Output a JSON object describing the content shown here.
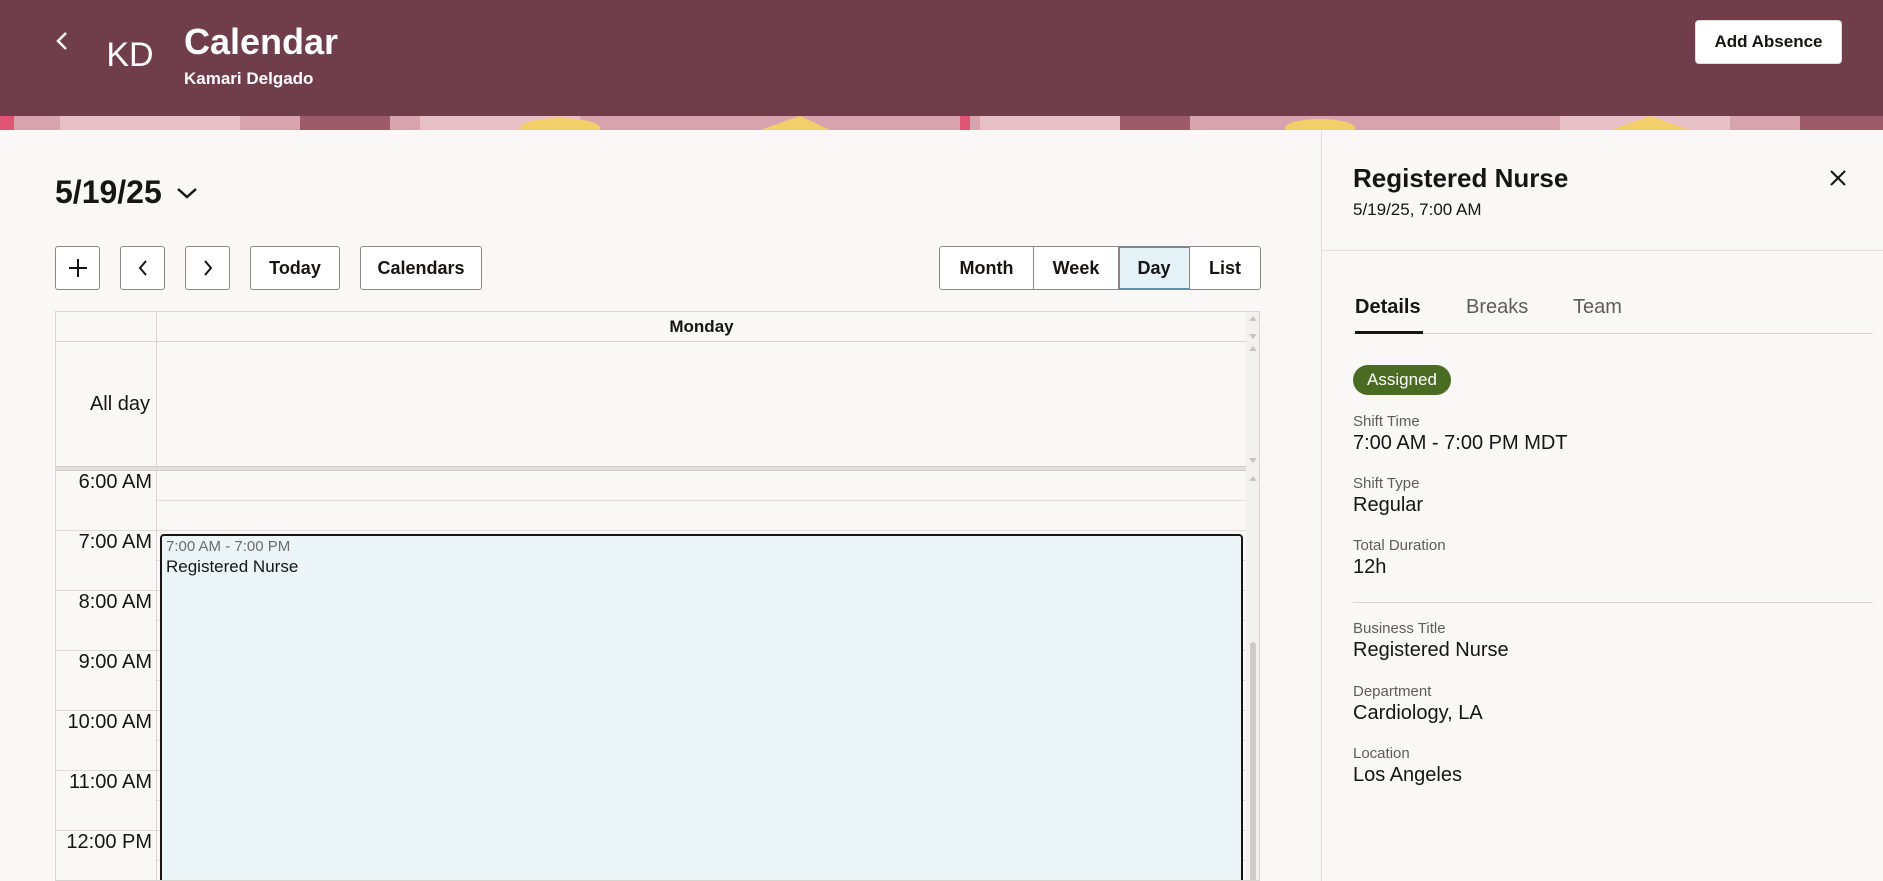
{
  "header": {
    "avatar_initials": "KD",
    "title": "Calendar",
    "subtitle": "Kamari Delgado",
    "add_absence_label": "Add Absence"
  },
  "toolbar": {
    "selected_date": "5/19/25",
    "today_label": "Today",
    "calendars_label": "Calendars",
    "views": [
      {
        "label": "Month",
        "active": false
      },
      {
        "label": "Week",
        "active": false
      },
      {
        "label": "Day",
        "active": true
      },
      {
        "label": "List",
        "active": false
      }
    ]
  },
  "calendar": {
    "day_header": "Monday",
    "all_day_label": "All day",
    "time_labels": [
      "6:00 AM",
      "7:00 AM",
      "8:00 AM",
      "9:00 AM",
      "10:00 AM",
      "11:00 AM",
      "12:00 PM"
    ],
    "event": {
      "time": "7:00 AM - 7:00 PM",
      "title": "Registered Nurse"
    }
  },
  "panel": {
    "title": "Registered Nurse",
    "subtitle": "5/19/25, 7:00 AM",
    "tabs": [
      "Details",
      "Breaks",
      "Team"
    ],
    "status": "Assigned",
    "fields": [
      {
        "label": "Shift Time",
        "value": "7:00 AM - 7:00 PM MDT"
      },
      {
        "label": "Shift Type",
        "value": "Regular"
      },
      {
        "label": "Total Duration",
        "value": "12h"
      },
      {
        "label": "Business Title",
        "value": "Registered Nurse"
      },
      {
        "label": "Department",
        "value": "Cardiology, LA"
      },
      {
        "label": "Location",
        "value": "Los Angeles"
      }
    ]
  },
  "colors": {
    "header_bg": "#703e4b",
    "event_bg": "#ecf5f8",
    "status_badge": "#4a6b22",
    "active_view_bg": "#e4f1f7"
  }
}
